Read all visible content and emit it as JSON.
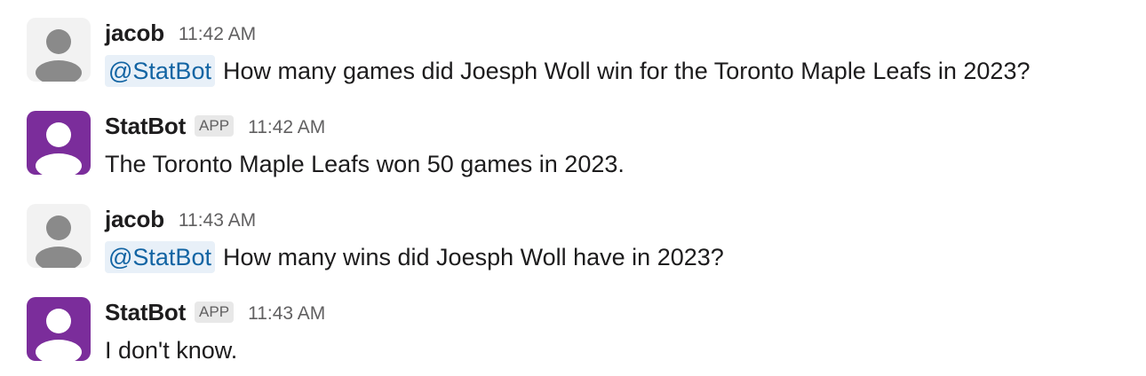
{
  "colors": {
    "user_avatar_bg": "#f2f2f2",
    "user_avatar_fg": "#8a8a8a",
    "bot_avatar_bg": "#7b2d9b",
    "bot_avatar_fg": "#ffffff",
    "mention_bg": "#e8f0f8",
    "mention_text": "#1264a3"
  },
  "messages": [
    {
      "author": "jacob",
      "time": "11:42 AM",
      "mention": "@StatBot",
      "text": "How many games did Joesph Woll win for the Toronto Maple Leafs in 2023?",
      "avatar_icon": "user-silhouette-icon"
    },
    {
      "author": "StatBot",
      "badge": "APP",
      "time": "11:42 AM",
      "text": "The Toronto Maple Leafs won 50 games in 2023.",
      "avatar_icon": "bot-silhouette-icon"
    },
    {
      "author": "jacob",
      "time": "11:43 AM",
      "mention": "@StatBot",
      "text": "How many wins did Joesph Woll have in 2023?",
      "avatar_icon": "user-silhouette-icon"
    },
    {
      "author": "StatBot",
      "badge": "APP",
      "time": "11:43 AM",
      "text": "I don't know.",
      "avatar_icon": "bot-silhouette-icon"
    }
  ]
}
